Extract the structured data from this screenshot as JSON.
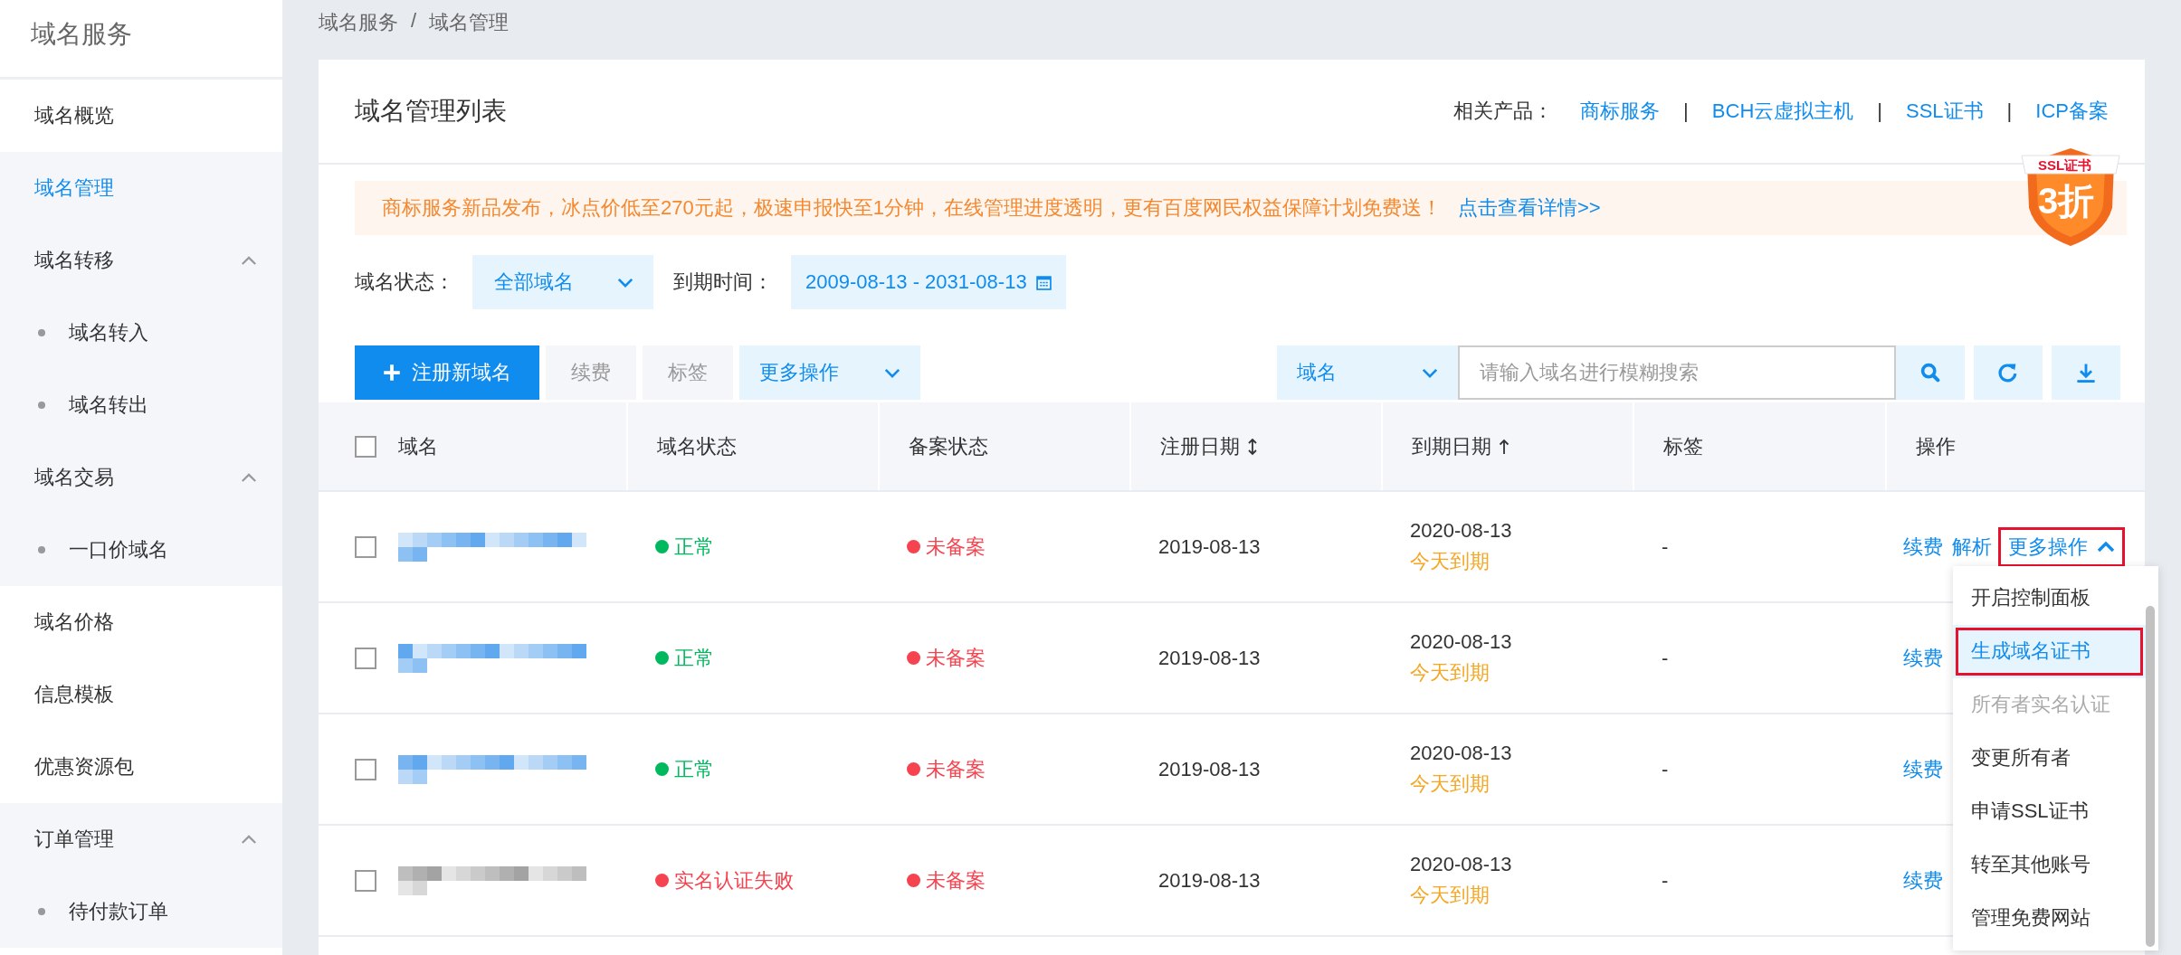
{
  "sidebar": {
    "title": "域名服务",
    "items": [
      {
        "label": "域名概览",
        "selected": false
      },
      {
        "label": "域名管理",
        "selected": true
      },
      {
        "label": "域名转移",
        "selected": false,
        "expanded": true,
        "children": [
          {
            "label": "域名转入",
            "selected": false
          },
          {
            "label": "域名转出",
            "selected": false
          }
        ]
      },
      {
        "label": "域名交易",
        "selected": false,
        "expanded": true,
        "children": [
          {
            "label": "一口价域名",
            "selected": false
          }
        ]
      },
      {
        "label": "域名价格",
        "selected": false
      },
      {
        "label": "信息模板",
        "selected": false
      },
      {
        "label": "优惠资源包",
        "selected": false
      },
      {
        "label": "订单管理",
        "selected": false,
        "expanded": true,
        "children": [
          {
            "label": "待付款订单",
            "selected": false
          }
        ]
      }
    ]
  },
  "breadcrumb": {
    "items": [
      "域名服务",
      "域名管理"
    ],
    "separator": "/"
  },
  "card": {
    "title": "域名管理列表",
    "related": {
      "label": "相关产品：",
      "separator": "|",
      "links": [
        "商标服务",
        "BCH云虚拟主机",
        "SSL证书",
        "ICP备案"
      ]
    }
  },
  "notice": {
    "text": "商标服务新品发布，冰点价低至270元起，极速申报快至1分钟，在线管理进度透明，更有百度网民权益保障计划免费送！",
    "link": "点击查看详情>>"
  },
  "promo_badge": {
    "ribbon": "SSL证书",
    "discount": "3折"
  },
  "filters": [
    {
      "label": "域名状态：",
      "kind": "select",
      "value": "全部域名"
    },
    {
      "label": "到期时间：",
      "kind": "daterange",
      "value": "2009-08-13 - 2031-08-13"
    }
  ],
  "toolbar": {
    "buttons": [
      {
        "label": "注册新域名",
        "kind": "primary"
      },
      {
        "label": "续费",
        "kind": "disabled"
      },
      {
        "label": "标签",
        "kind": "disabled"
      },
      {
        "label": "更多操作",
        "kind": "dropdown"
      }
    ],
    "search": {
      "field": "域名",
      "placeholder": "请输入域名进行模糊搜索"
    }
  },
  "table": {
    "select_all": {
      "checked": false
    },
    "columns": [
      {
        "label": "域名",
        "kind": "plain"
      },
      {
        "label": "域名状态",
        "kind": "plain"
      },
      {
        "label": "备案状态",
        "kind": "plain"
      },
      {
        "label": "注册日期",
        "kind": "sortable"
      },
      {
        "label": "到期日期",
        "kind": "ascending"
      },
      {
        "label": "标签",
        "kind": "plain"
      },
      {
        "label": "操作",
        "kind": "plain"
      }
    ],
    "rows": [
      {
        "checked": false,
        "domain": {
          "kind": "link"
        },
        "status": {
          "text": "正常",
          "color": "#00b95f"
        },
        "filing": {
          "text": "未备案",
          "color": "#f5434f"
        },
        "registered": "2019-08-13",
        "expires": "2020-08-13",
        "expiry_note": "今天到期",
        "tag": "-",
        "actions": [
          {
            "label": "续费",
            "kind": "link"
          },
          {
            "label": "解析",
            "kind": "link"
          },
          {
            "label": "更多操作",
            "kind": "menu",
            "expanded": true,
            "annotated": true,
            "menu": [
              {
                "label": "开启控制面板",
                "selected": false,
                "disabled": false,
                "annotated": false
              },
              {
                "label": "生成域名证书",
                "selected": true,
                "disabled": false,
                "annotated": true
              },
              {
                "label": "所有者实名认证",
                "selected": false,
                "disabled": true,
                "annotated": false
              },
              {
                "label": "变更所有者",
                "selected": false,
                "disabled": false,
                "annotated": false
              },
              {
                "label": "申请SSL证书",
                "selected": false,
                "disabled": false,
                "annotated": false
              },
              {
                "label": "转至其他账号",
                "selected": false,
                "disabled": false,
                "annotated": false
              },
              {
                "label": "管理免费网站",
                "selected": false,
                "disabled": false,
                "annotated": false
              }
            ]
          }
        ]
      },
      {
        "checked": false,
        "domain": {
          "kind": "link"
        },
        "status": {
          "text": "正常",
          "color": "#00b95f"
        },
        "filing": {
          "text": "未备案",
          "color": "#f5434f"
        },
        "registered": "2019-08-13",
        "expires": "2020-08-13",
        "expiry_note": "今天到期",
        "tag": "-",
        "actions": [
          {
            "label": "续费",
            "kind": "link"
          }
        ]
      },
      {
        "checked": false,
        "domain": {
          "kind": "link"
        },
        "status": {
          "text": "正常",
          "color": "#00b95f"
        },
        "filing": {
          "text": "未备案",
          "color": "#f5434f"
        },
        "registered": "2019-08-13",
        "expires": "2020-08-13",
        "expiry_note": "今天到期",
        "tag": "-",
        "actions": [
          {
            "label": "续费",
            "kind": "link"
          }
        ]
      },
      {
        "checked": false,
        "domain": {
          "kind": "plain"
        },
        "status": {
          "text": "实名认证失败",
          "color": "#f5434f"
        },
        "filing": {
          "text": "未备案",
          "color": "#f5434f"
        },
        "registered": "2019-08-13",
        "expires": "2020-08-13",
        "expiry_note": "今天到期",
        "tag": "-",
        "actions": [
          {
            "label": "续费",
            "kind": "link"
          }
        ]
      }
    ]
  }
}
